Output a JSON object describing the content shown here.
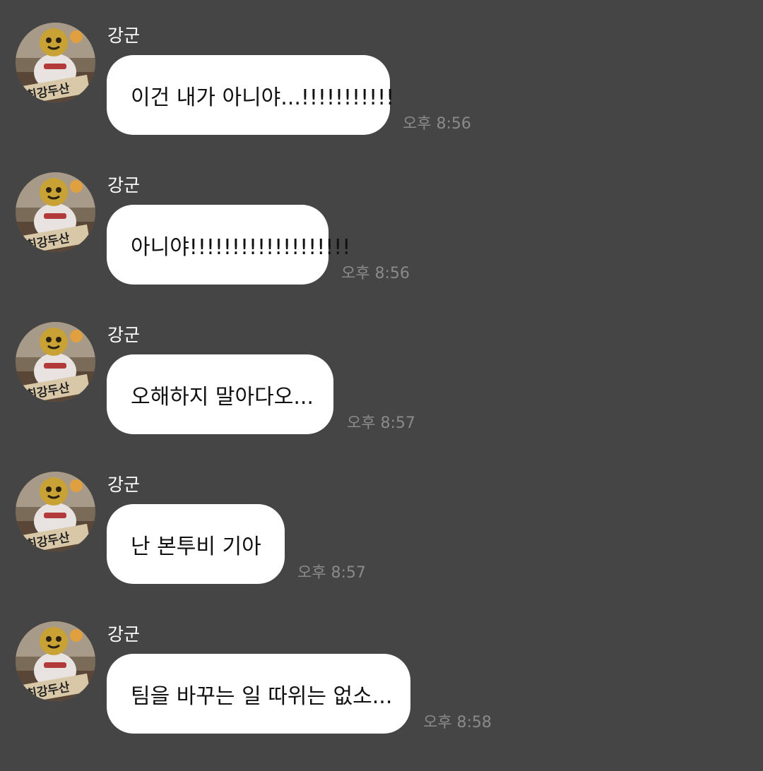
{
  "colors": {
    "background": "#454545",
    "bubble": "#ffffff",
    "message_text": "#111111",
    "sender_text": "#ffffff",
    "time_text": "#8a8a8a"
  },
  "messages": [
    {
      "sender": "강군",
      "text": "이건 내가 아니야...!!!!!!!!!!!",
      "time": "오후 8:56"
    },
    {
      "sender": "강군",
      "text": "아니야!!!!!!!!!!!!!!!!!!!",
      "time": "오후 8:56"
    },
    {
      "sender": "강군",
      "text": "오해하지 말아다오...",
      "time": "오후 8:57"
    },
    {
      "sender": "강군",
      "text": "난 본투비 기아",
      "time": "오후 8:57"
    },
    {
      "sender": "강군",
      "text": "팀을 바꾸는 일 따위는 없소...",
      "time": "오후 8:58"
    }
  ]
}
